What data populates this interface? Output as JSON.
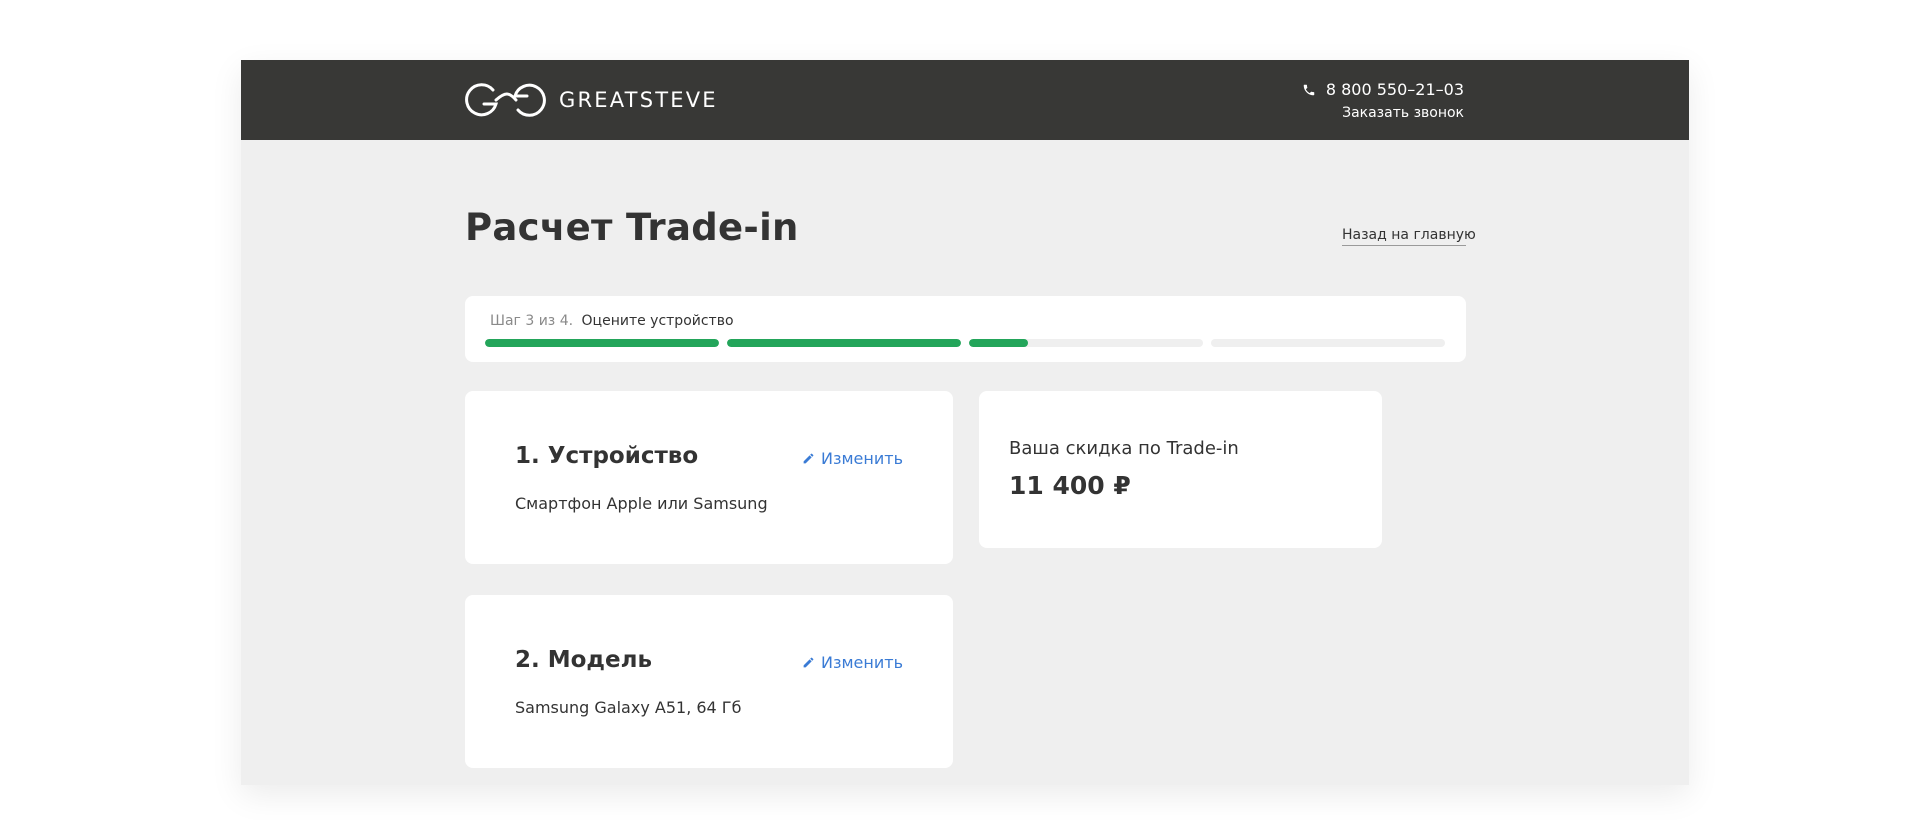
{
  "header": {
    "brand": "GREATSTEVE",
    "phone": "8 800 550–21–03",
    "callback_label": "Заказать звонок",
    "phone_icon": "phone-icon",
    "background_color": "#383836"
  },
  "page": {
    "title": "Расчет Trade-in",
    "back_link": "Назад на главную"
  },
  "progress": {
    "step_count": "Шаг 3 из 4.",
    "step_name": "Оцените устройство",
    "bars": [
      1,
      1,
      0.25,
      0
    ],
    "accent_color": "#23a55a"
  },
  "cards": {
    "device": {
      "title": "1. Устройство",
      "value": "Смартфон Apple или Samsung",
      "edit_label": "Изменить"
    },
    "model": {
      "title": "2. Модель",
      "value": "Samsung Galaxy A51, 64 Гб",
      "edit_label": "Изменить"
    }
  },
  "discount": {
    "label": "Ваша скидка по Trade-in",
    "value": "11 400 ₽"
  },
  "colors": {
    "link": "#3a7bd5",
    "page_bg": "#efefef"
  }
}
